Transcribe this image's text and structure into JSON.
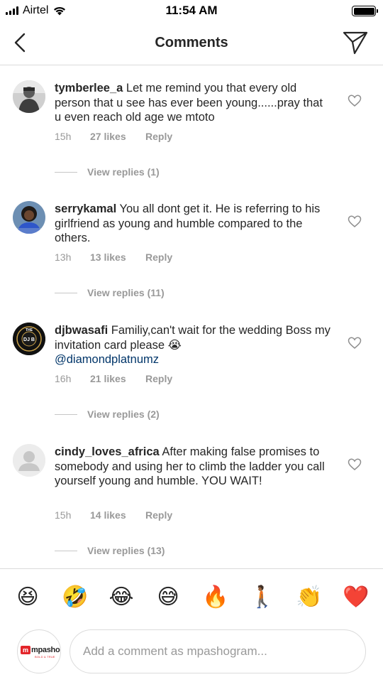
{
  "status_bar": {
    "carrier": "Airtel",
    "time": "11:54 AM"
  },
  "header": {
    "title": "Comments",
    "back_icon": "chevron-left-icon",
    "send_icon": "paper-plane-icon"
  },
  "comments": [
    {
      "username": "tymberlee_a",
      "text": "Let me remind you that every old person that u see has ever been young......pray that u even reach old age we mtoto",
      "mention": "",
      "time": "15h",
      "likes": "27 likes",
      "reply_label": "Reply",
      "view_replies": "View replies (1)"
    },
    {
      "username": "serrykamal",
      "text": "You all dont get it. He is referring to his girlfriend as young and humble compared to the others.",
      "mention": "",
      "time": "13h",
      "likes": "13 likes",
      "reply_label": "Reply",
      "view_replies": "View replies (11)"
    },
    {
      "username": "djbwasafi",
      "text": "Familiy,can't wait for the  wedding Boss my invitation card please 😭",
      "mention": "@diamondplatnumz",
      "time": "16h",
      "likes": "21 likes",
      "reply_label": "Reply",
      "view_replies": "View replies (2)"
    },
    {
      "username": "cindy_loves_africa",
      "text": "After making false promises to somebody and using her to climb the ladder you call yourself young and humble. YOU WAIT!",
      "mention": "",
      "time": "15h",
      "likes": "14 likes",
      "reply_label": "Reply",
      "view_replies": "View replies (13)"
    }
  ],
  "avatar_text": {
    "djbwasafi_top": "THE",
    "djbwasafi_center": "DJ B"
  },
  "emoji_bar": [
    "😆",
    "🤣",
    "😂",
    "😅",
    "🔥",
    "🚶🏾",
    "👏",
    "❤️"
  ],
  "composer": {
    "logo_text": "mpasho",
    "logo_tagline": "BOLD & TRUE",
    "placeholder": "Add a comment as mpashogram..."
  }
}
